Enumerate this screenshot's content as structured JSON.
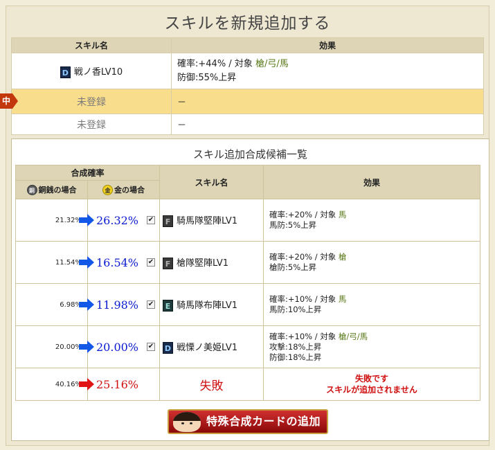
{
  "title": "スキルを新規追加する",
  "top_table": {
    "col_skill": "スキル名",
    "col_effect": "効果",
    "current": {
      "rank": "D",
      "name": "戦ノ香LV10",
      "effect_line1_prefix": "確率:+44% / 対象",
      "effect_line1_target": "槍/弓/馬",
      "effect_line2": "防御:55%上昇"
    },
    "marker": "中",
    "slot2": {
      "name": "未登録",
      "effect": "－"
    },
    "slot3": {
      "name": "未登録",
      "effect": "－"
    }
  },
  "candidates": {
    "title": "スキル追加合成候補一覧",
    "hdr_rate": "合成確率",
    "hdr_copper": "銅銭の場合",
    "hdr_gold": "金の場合",
    "hdr_skill": "スキル名",
    "hdr_effect": "効果",
    "coin_copper": "銅",
    "coin_gold": "金",
    "rows": [
      {
        "copper": "21.32%",
        "gold": "26.32%",
        "rank": "F",
        "skill": "騎馬隊堅陣LV1",
        "eff1": "確率:+20% / 対象",
        "target": "馬",
        "eff2": "馬防:5%上昇",
        "eff3": ""
      },
      {
        "copper": "11.54%",
        "gold": "16.54%",
        "rank": "F",
        "skill": "槍隊堅陣LV1",
        "eff1": "確率:+20% / 対象",
        "target": "槍",
        "eff2": "槍防:5%上昇",
        "eff3": ""
      },
      {
        "copper": "6.98%",
        "gold": "11.98%",
        "rank": "E",
        "skill": "騎馬隊布陣LV1",
        "eff1": "確率:+10% / 対象",
        "target": "馬",
        "eff2": "馬防:10%上昇",
        "eff3": ""
      },
      {
        "copper": "20.00%",
        "gold": "20.00%",
        "rank": "D",
        "skill": "戦慄ノ美姫LV1",
        "eff1": "確率:+10% / 対象",
        "target": "槍/弓/馬",
        "eff2": "攻撃:18%上昇",
        "eff3": "防御:18%上昇"
      }
    ],
    "fail": {
      "copper": "40.16%",
      "gold": "25.16%",
      "skill": "失敗",
      "eff1": "失敗です",
      "eff2": "スキルが追加されません"
    }
  },
  "add_button": "特殊合成カードの追加",
  "checkbox_mark": "✔"
}
